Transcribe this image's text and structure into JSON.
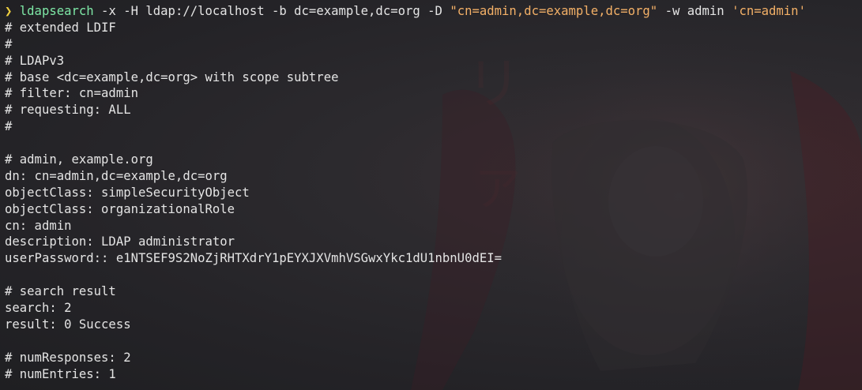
{
  "terminal": {
    "prompt_symbol": "❯",
    "command": {
      "name": "ldapsearch",
      "args_before": " -x -H ldap://localhost -b dc=example,dc=org -D ",
      "quoted_bind_dn": "\"cn=admin,dc=example,dc=org\"",
      "args_after": " -w admin ",
      "quoted_filter": "'cn=admin'"
    },
    "output": [
      "# extended LDIF",
      "#",
      "# LDAPv3",
      "# base <dc=example,dc=org> with scope subtree",
      "# filter: cn=admin",
      "# requesting: ALL",
      "#",
      "",
      "# admin, example.org",
      "dn: cn=admin,dc=example,dc=org",
      "objectClass: simpleSecurityObject",
      "objectClass: organizationalRole",
      "cn: admin",
      "description: LDAP administrator",
      "userPassword:: e1NTSEF9S2NoZjRHTXdrY1pEYXJXVmhVSGwxYkc1dU1nbnU0dEI=",
      "",
      "# search result",
      "search: 2",
      "result: 0 Success",
      "",
      "# numResponses: 2",
      "# numEntries: 1"
    ]
  },
  "colors": {
    "background": "#242327",
    "foreground": "#e4e4e4",
    "prompt": "#f0d040",
    "command": "#7ee8a6",
    "string": "#f3b067",
    "wallpaper_accent": "#5a1f28"
  }
}
